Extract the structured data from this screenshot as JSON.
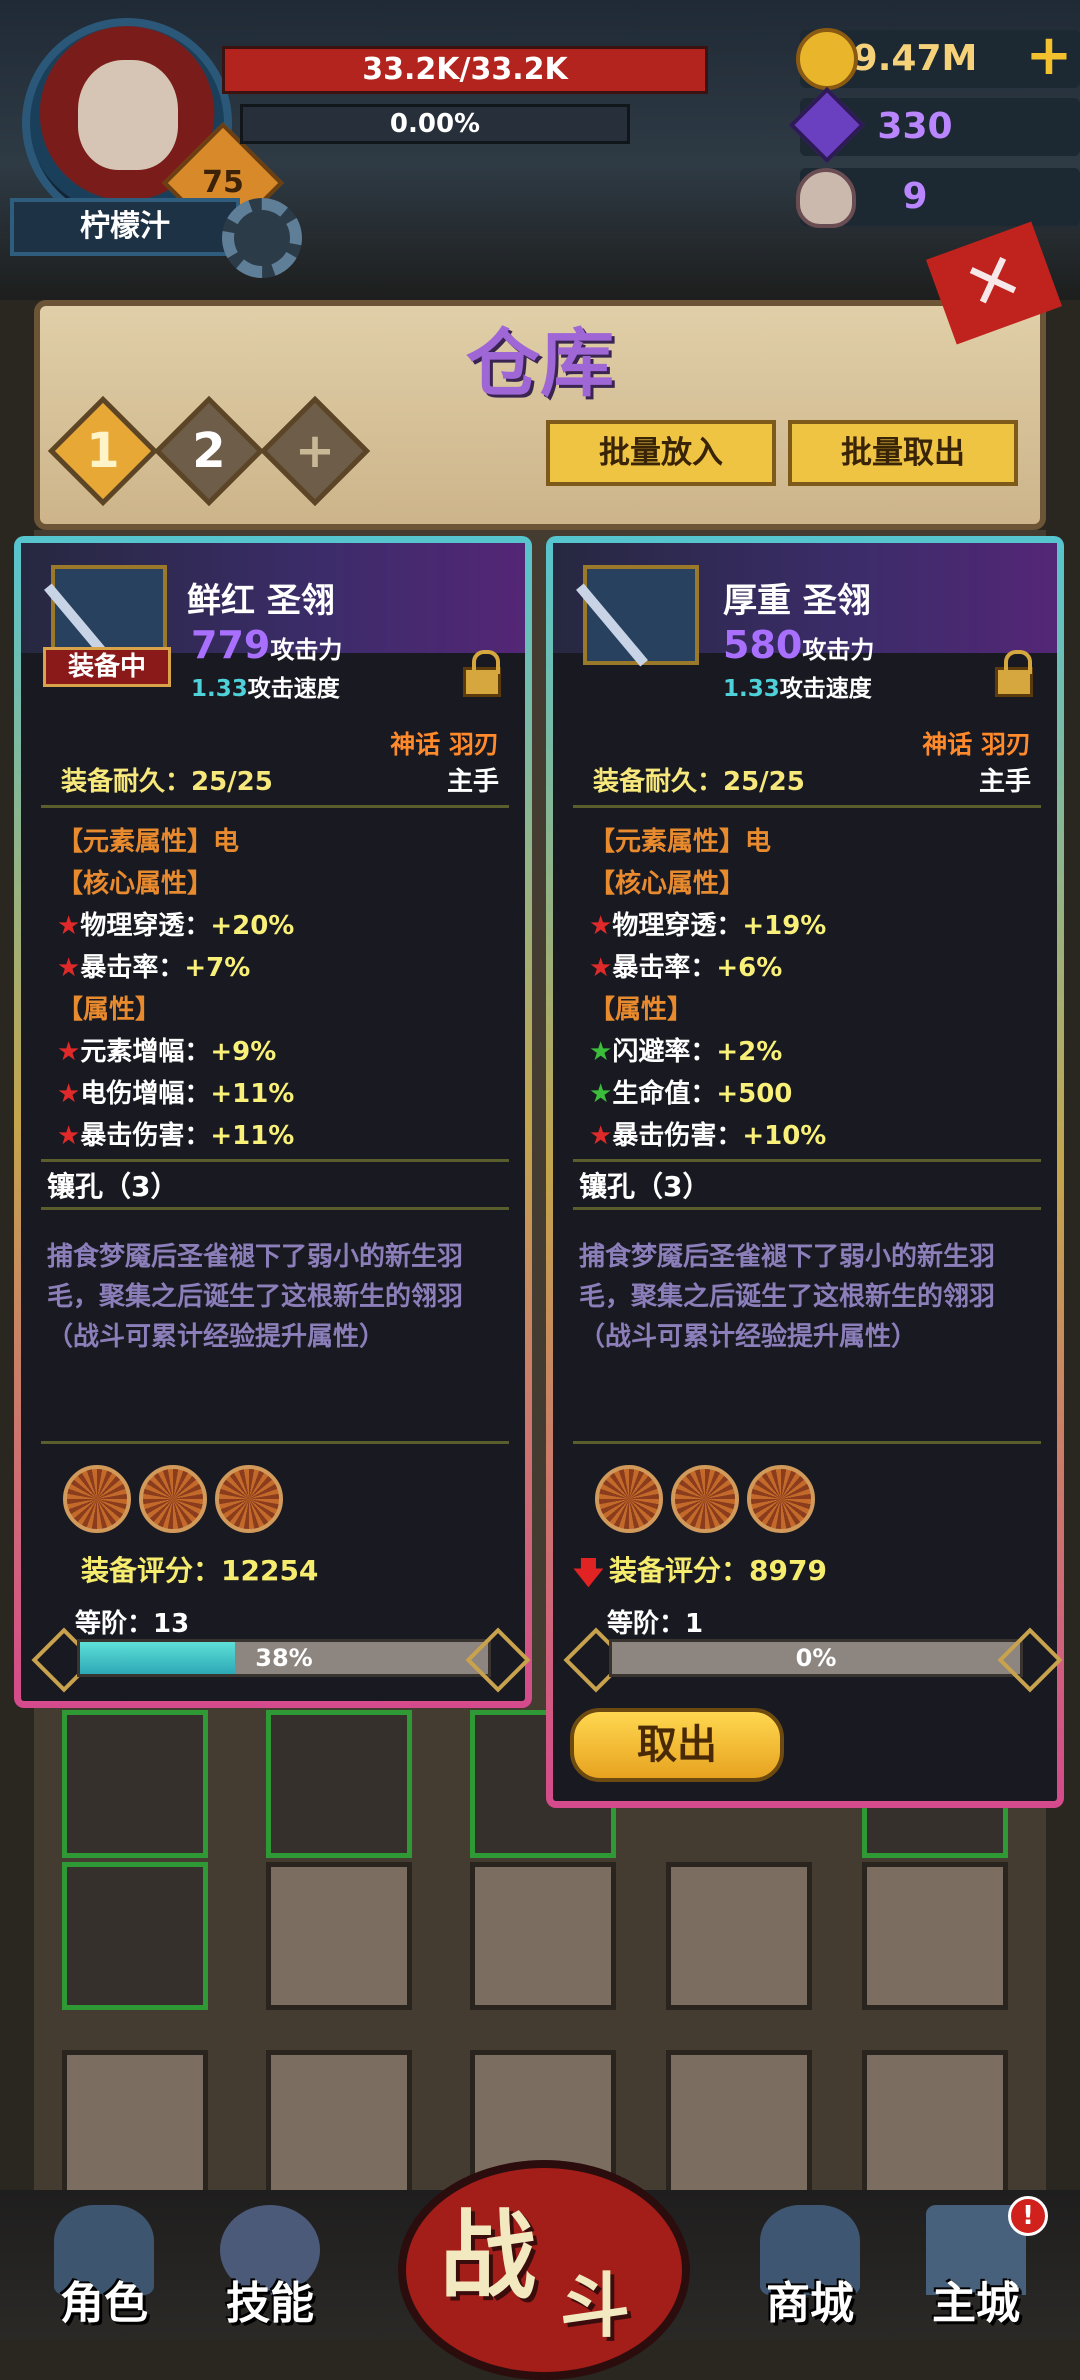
{
  "player": {
    "name": "柠檬汁",
    "level": "75",
    "hp": "33.2K/33.2K",
    "exp": "0.00%"
  },
  "resources": {
    "gold": "9.47M",
    "gems": "330",
    "skulls": "9"
  },
  "warehouse": {
    "title": "仓库",
    "tabs": [
      "1",
      "2",
      "+"
    ],
    "batch_put_label": "批量放入",
    "batch_take_label": "批量取出"
  },
  "cards": [
    {
      "name": "鲜红 圣翎",
      "equipped_tag": "装备中",
      "attack_value": "779",
      "attack_label": "攻击力",
      "speed_value": "1.33",
      "speed_label": "攻击速度",
      "rarity": "神话 羽刃",
      "durability": "装备耐久：25/25",
      "hand": "主手",
      "element": "【元素属性】电",
      "core_title": "【核心属性】",
      "core_stats": [
        {
          "label": "物理穿透：",
          "value": "+20%"
        },
        {
          "label": "暴击率：",
          "value": "+7%"
        }
      ],
      "attr_title": "【属性】",
      "attr_stats": [
        {
          "label": "元素增幅：",
          "value": "+9%"
        },
        {
          "label": "电伤增幅：",
          "value": "+11%"
        },
        {
          "label": "暴击伤害：",
          "value": "+11%"
        }
      ],
      "sockets_title": "镶孔（3）",
      "description": "捕食梦魇后圣雀褪下了弱小的新生羽毛，聚集之后诞生了这根新生的翎羽（战斗可累计经验提升属性）",
      "score": "装备评分：12254",
      "tier": "等阶：13",
      "tier_progress": 0.38,
      "tier_pct": "38%"
    },
    {
      "name": "厚重 圣翎",
      "attack_value": "580",
      "attack_label": "攻击力",
      "speed_value": "1.33",
      "speed_label": "攻击速度",
      "rarity": "神话 羽刃",
      "durability": "装备耐久：25/25",
      "hand": "主手",
      "element": "【元素属性】电",
      "core_title": "【核心属性】",
      "core_stats": [
        {
          "label": "物理穿透：",
          "value": "+19%"
        },
        {
          "label": "暴击率：",
          "value": "+6%"
        }
      ],
      "attr_title": "【属性】",
      "attr_stats": [
        {
          "label": "闪避率：",
          "value": "+2%"
        },
        {
          "label": "生命值：",
          "value": "+500"
        },
        {
          "label": "暴击伤害：",
          "value": "+10%"
        }
      ],
      "sockets_title": "镶孔（3）",
      "description": "捕食梦魇后圣雀褪下了弱小的新生羽毛，聚集之后诞生了这根新生的翎羽（战斗可累计经验提升属性）",
      "score": "装备评分：8979",
      "tier": "等阶：1",
      "tier_progress": 0.0,
      "tier_pct": "0%",
      "takeout_label": "取出"
    }
  ],
  "nav": {
    "role": "角色",
    "skills": "技能",
    "battle_1": "战",
    "battle_2": "斗",
    "shop": "商城",
    "city": "主城",
    "city_badge": "!"
  },
  "colors": {
    "hp": "#b4241f",
    "gold": "#e9b52b",
    "gem": "#6a40c0",
    "rarity": "#ff8a2b",
    "stat_value": "#f8f078",
    "tier_fill": "#2ca8b6"
  }
}
